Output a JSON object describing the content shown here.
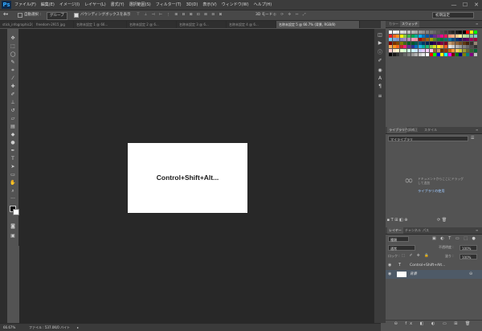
{
  "app": {
    "logo": "Ps"
  },
  "menu": [
    "ファイル(F)",
    "編集(E)",
    "イメージ(I)",
    "レイヤー(L)",
    "書式(Y)",
    "選択範囲(S)",
    "フィルター(T)",
    "3D(D)",
    "表示(V)",
    "ウィンドウ(W)",
    "ヘルプ(H)"
  ],
  "window_controls": {
    "minimize": "—",
    "maximize": "☐",
    "close": "✕"
  },
  "options": {
    "auto_select_label": "自動選択 :",
    "auto_select_value": "グループ",
    "bounding_box_label": "バウンディングボックスを表示",
    "mode_3d": "3D モード :"
  },
  "workspace_selector": "初期設定",
  "tabs": [
    {
      "label": "stick_infographic2(1).jpg",
      "active": false
    },
    {
      "label": "freedom-2915 jpg",
      "active": false
    },
    {
      "label": "名称未設定 1 @ 66...",
      "active": false
    },
    {
      "label": "名称未設定 2 @ 6...",
      "active": false
    },
    {
      "label": "名称未設定 3 @ 6...",
      "active": false
    },
    {
      "label": "名称未設定 4 @ 6...",
      "active": false
    },
    {
      "label": "名称未設定 5 @ 66.7% (背景, RGB/8)",
      "active": true
    }
  ],
  "canvas": {
    "text": "Control+Shift+Alt..."
  },
  "status": {
    "zoom": "66.67%",
    "info": "ファイル : 537.0K/0 バイト"
  },
  "panels": {
    "color_tabs": [
      "カラー",
      "スウォッチ"
    ],
    "library_tabs": [
      "ライブラリ",
      "色調補正",
      "スタイル"
    ],
    "library_select": "マイライブラリ",
    "library_message": "ドキュメントからここにドラッグ して追加",
    "library_link": "ライブラリの使用",
    "layer_tabs": [
      "レイヤー",
      "チャンネル",
      "パス"
    ],
    "layer_filter": "種類",
    "blend_mode": "通常",
    "opacity_label": "不透明度 :",
    "opacity_value": "100%",
    "fill_label": "塗り :",
    "fill_value": "100%",
    "lock_label": "ロック :",
    "layers": [
      {
        "name": "Control+Shift+Alt...",
        "type": "text",
        "selected": false
      },
      {
        "name": "背景",
        "type": "image",
        "selected": true
      }
    ]
  },
  "colors": {
    "accent": "#31a8ff",
    "canvas_bg": "#282828",
    "panel_bg": "#535353",
    "selected_layer": "#4e5a67"
  }
}
